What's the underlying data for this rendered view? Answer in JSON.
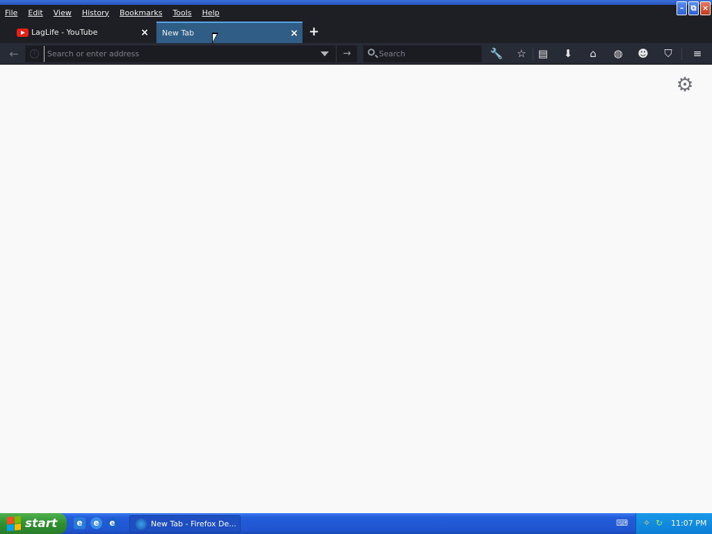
{
  "window": {
    "buttons": {
      "minimize": "–",
      "restore": "⧉",
      "close": "×"
    }
  },
  "menubar": {
    "items": [
      "File",
      "Edit",
      "View",
      "History",
      "Bookmarks",
      "Tools",
      "Help"
    ]
  },
  "tabs": [
    {
      "label": "LagLife - YouTube",
      "icon": "youtube-icon",
      "active": false,
      "close": "×"
    },
    {
      "label": "New Tab",
      "icon": "",
      "active": true,
      "close": "×"
    }
  ],
  "tabbar": {
    "newtab": "+"
  },
  "navbar": {
    "back": "←",
    "address_placeholder": "Search or enter address",
    "go": "→",
    "search_placeholder": "Search",
    "toolbar_icons": {
      "wrench": "🔧",
      "bookmark_star": "☆",
      "reader": "▤",
      "downloads": "⬇",
      "home": "⌂",
      "shield": "◍",
      "smiley": "☻",
      "pocket": "⛉",
      "menu": "≡"
    }
  },
  "content": {
    "gear": "⚙"
  },
  "taskbar": {
    "start_label": "start",
    "quicklaunch": [
      "e",
      "e",
      "e"
    ],
    "task_label": "New Tab - Firefox De...",
    "clock": "11:07 PM",
    "tray_left": "⌨",
    "tray_icons": [
      "✧",
      "↻"
    ]
  },
  "colors": {
    "chrome_dark": "#1d1f24",
    "toolbar": "#272b35",
    "active_tab": "#2f5d86",
    "active_tab_accent": "#5aa4e8",
    "page_background": "#f9f9fa",
    "taskbar_blue": "#245edb",
    "start_green": "#2f8f2f"
  }
}
